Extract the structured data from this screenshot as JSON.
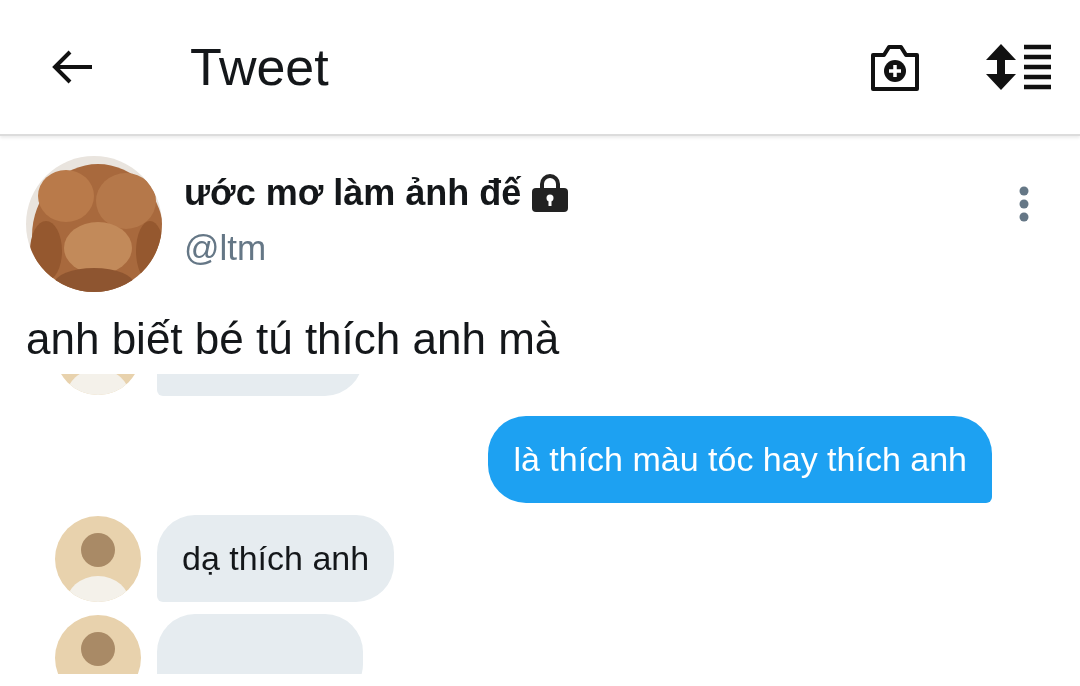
{
  "header": {
    "title": "Tweet"
  },
  "tweet": {
    "author": {
      "name": "ước mơ làm ảnh đế",
      "protected": true,
      "handle": "@ltm"
    },
    "text": "anh biết bé tú thích anh mà",
    "conversation": [
      {
        "kind": "received"
      },
      {
        "kind": "sent",
        "text": "là thích màu tóc hay thích anh"
      },
      {
        "kind": "received",
        "text": "dạ thích anh"
      },
      {
        "kind": "received"
      }
    ]
  }
}
